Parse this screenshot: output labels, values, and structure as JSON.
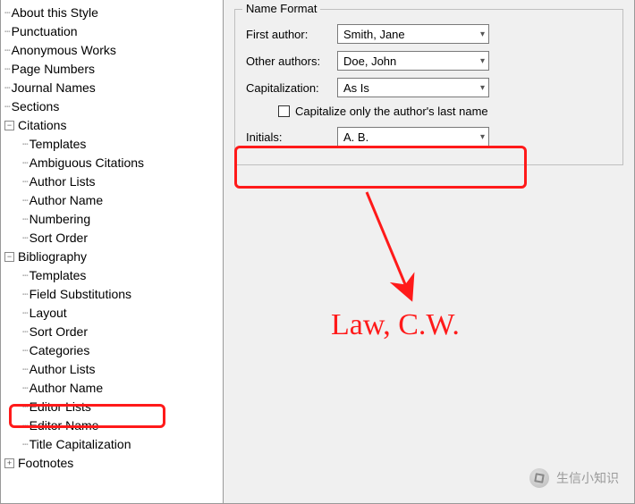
{
  "tree": {
    "top": [
      "About this Style",
      "Punctuation",
      "Anonymous Works",
      "Page Numbers",
      "Journal Names",
      "Sections"
    ],
    "citations": {
      "label": "Citations",
      "children": [
        "Templates",
        "Ambiguous Citations",
        "Author Lists",
        "Author Name",
        "Numbering",
        "Sort Order"
      ]
    },
    "bibliography": {
      "label": "Bibliography",
      "children": [
        "Templates",
        "Field Substitutions",
        "Layout",
        "Sort Order",
        "Categories",
        "Author Lists",
        "Author Name",
        "Editor Lists",
        "Editor Name",
        "Title Capitalization"
      ]
    },
    "footnotes": {
      "label": "Footnotes"
    }
  },
  "form": {
    "legend": "Name Format",
    "first_author": {
      "label": "First author:",
      "value": "Smith, Jane"
    },
    "other_authors": {
      "label": "Other authors:",
      "value": "Doe, John"
    },
    "capitalization": {
      "label": "Capitalization:",
      "value": "As Is"
    },
    "capitalize_last": {
      "label": "Capitalize only the author's last name",
      "checked": false
    },
    "initials": {
      "label": "Initials:",
      "value": "A. B."
    }
  },
  "annotation": {
    "text": "Law, C.W."
  },
  "watermark": {
    "text": "生信小知识"
  }
}
